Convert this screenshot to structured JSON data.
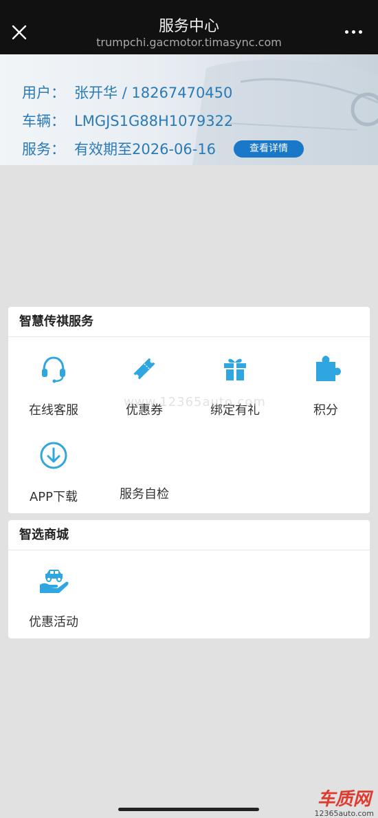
{
  "nav": {
    "title": "服务中心",
    "url": "trumpchi.gacmotor.timasync.com"
  },
  "banner": {
    "user_label": "用户：",
    "user_value": "张开华 / 18267470450",
    "vehicle_label": "车辆：",
    "vehicle_value": "LMGJS1G88H1079322",
    "service_label": "服务：",
    "service_value": "有效期至2026-06-16",
    "detail_button": "查看详情"
  },
  "services": {
    "title": "智慧传祺服务",
    "items": [
      {
        "label": "在线客服",
        "icon": "headset-icon"
      },
      {
        "label": "优惠券",
        "icon": "ticket-icon"
      },
      {
        "label": "绑定有礼",
        "icon": "gift-icon"
      },
      {
        "label": "积分",
        "icon": "puzzle-icon"
      },
      {
        "label": "APP下载",
        "icon": "download-icon"
      },
      {
        "label": "服务自检",
        "icon": ""
      }
    ]
  },
  "mall": {
    "title": "智选商城",
    "items": [
      {
        "label": "优惠活动",
        "icon": "car-in-hand-icon"
      }
    ]
  },
  "watermark": "www.12365auto.com",
  "logo": {
    "big": "车质网",
    "small": "12365auto.com"
  },
  "colors": {
    "accent": "#1a78c8",
    "icon_blue": "#2fa6e0",
    "info_text": "#2a7ab6",
    "navbar": "#111111"
  }
}
